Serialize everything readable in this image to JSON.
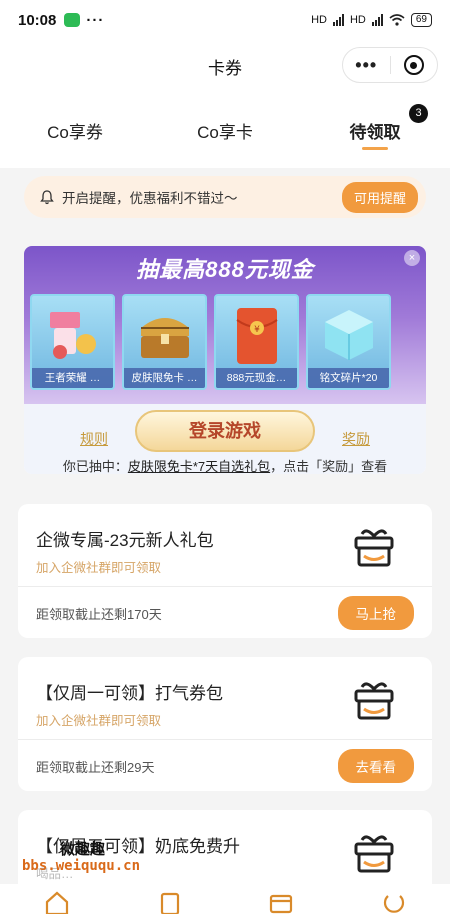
{
  "status_bar": {
    "time": "10:08",
    "dots": "···",
    "network1": "HD",
    "network2": "HD",
    "battery": "69"
  },
  "nav": {
    "title": "卡券",
    "more": "•••"
  },
  "tabs": [
    {
      "label": "Co享券"
    },
    {
      "label": "Co享卡"
    },
    {
      "label": "待领取",
      "badge": "3"
    }
  ],
  "reminder": {
    "text": "开启提醒，优惠福利不错过～",
    "button": "可用提醒"
  },
  "lottery": {
    "headline": "抽最高888元现金",
    "close": "×",
    "prizes": [
      {
        "label": "王者荣耀 …"
      },
      {
        "label": "皮肤限免卡 …"
      },
      {
        "label": "888元现金…"
      },
      {
        "label": "铭文碎片*20"
      }
    ],
    "rules": "规则",
    "login": "登录游戏",
    "reward": "奖励",
    "won_prefix": "你已抽中：",
    "won_item": "皮肤限免卡*7天自选礼包",
    "won_suffix": "，点击「奖励」查看"
  },
  "coupons": [
    {
      "title": "企微专属-23元新人礼包",
      "subtitle": "加入企微社群即可领取",
      "deadline": "距领取截止还剩170天",
      "button": "马上抢"
    },
    {
      "title": "【仅周一可领】打气券包",
      "subtitle": "加入企微社群即可领取",
      "deadline": "距领取截止还剩29天",
      "button": "去看看"
    },
    {
      "title": "【仅周五可领】奶底免费升",
      "subtitle": "喝品…"
    }
  ],
  "watermark": {
    "top": "微趣趣",
    "url": "bbs.weiququ.cn"
  },
  "colors": {
    "accent": "#f19a3e",
    "reminder_bg": "#fdf0e3",
    "subtitle": "#d6a567",
    "banner_purple": "#7c55c9"
  }
}
